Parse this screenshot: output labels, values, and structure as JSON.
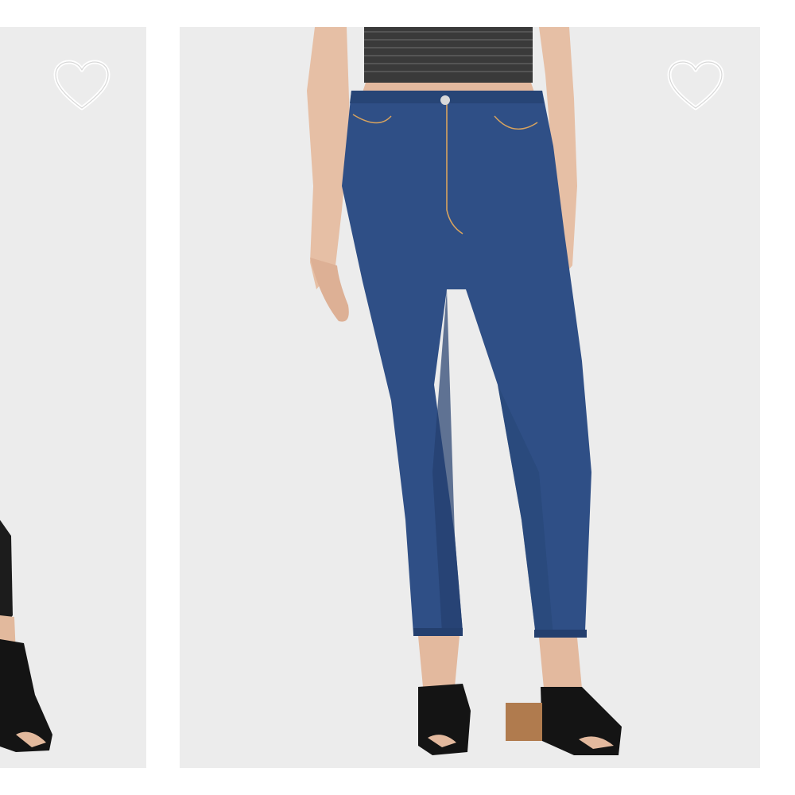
{
  "colors": {
    "page_background": "#ffffff",
    "card_background": "#ececec",
    "denim": "#2f4f86",
    "denim_shadow": "#243f6e",
    "top_fabric": "#3a3a3a",
    "skin": "#e7c1a7",
    "shoe": "#141414",
    "heel": "#b07b4e",
    "heart_outline": "#ffffff"
  },
  "gallery": {
    "items": [
      {
        "icon": "heart-outline-icon",
        "image": "partial-product-photo-black-pants-mule-shoe"
      },
      {
        "icon": "heart-outline-icon",
        "image": "product-photo-high-rise-blue-jeans-black-mules"
      }
    ]
  }
}
